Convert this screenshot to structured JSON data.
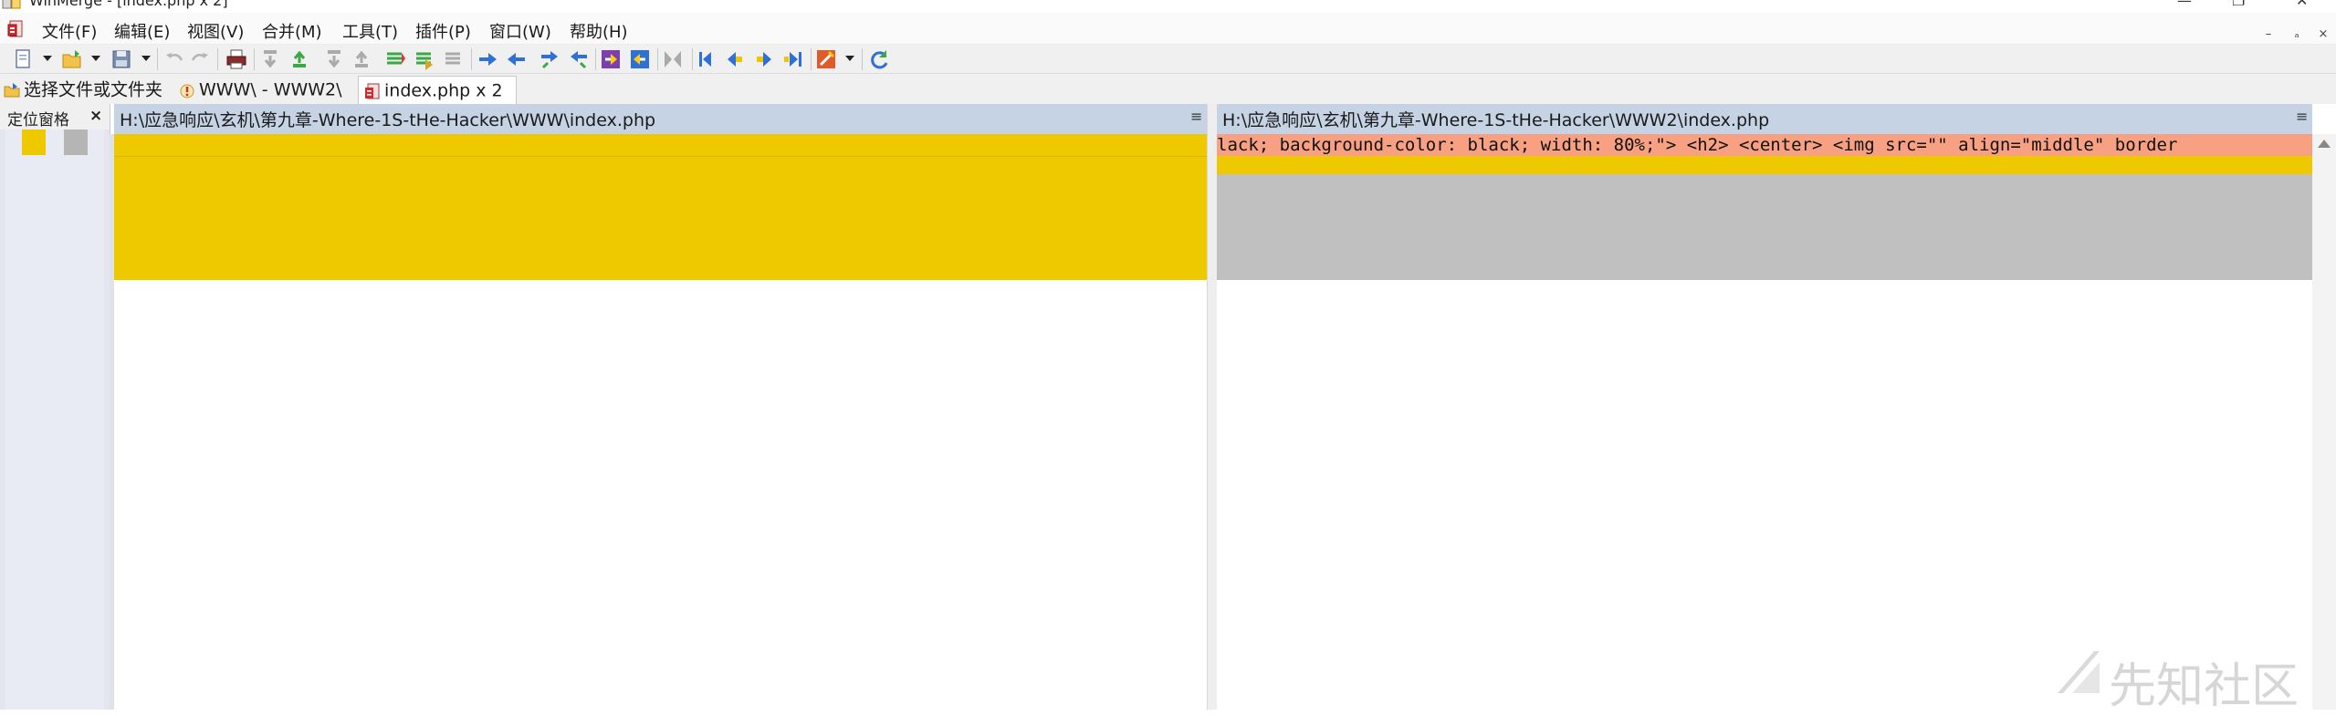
{
  "window": {
    "title": "WinMerge - [index.php x 2]",
    "controls": [
      "—",
      "❐",
      "✕"
    ]
  },
  "menu": {
    "items": [
      "文件(F)",
      "编辑(E)",
      "视图(V)",
      "合并(M)",
      "工具(T)",
      "插件(P)",
      "窗口(W)",
      "帮助(H)"
    ],
    "mdi_controls": [
      "–",
      "ₐ",
      "×"
    ]
  },
  "tabs": [
    {
      "label": "选择文件或文件夹",
      "icon": "open-folder-icon",
      "active": false
    },
    {
      "label": "WWW\\ - WWW2\\",
      "icon": "folder-compare-icon",
      "active": false
    },
    {
      "label": "index.php x 2",
      "icon": "file-compare-icon",
      "active": true
    }
  ],
  "location_pane": {
    "title": "定位窗格",
    "close": "×"
  },
  "left_pane": {
    "path": "H:\\应急响应\\玄机\\第九章-Where-1S-tHe-Hacker\\WWW\\index.php",
    "menu_icon": "≡"
  },
  "right_pane": {
    "path": "H:\\应急响应\\玄机\\第九章-Where-1S-tHe-Hacker\\WWW2\\index.php",
    "menu_icon": "≡",
    "line_1": "lack; background-color: black; width: 80%;\"> <h2> <center> <img src=\"\" align=\"middle\" border"
  },
  "colors": {
    "diff_yellow": "#efc900",
    "diff_salmon": "#f7a082",
    "missing_gray": "#c0c0c0",
    "pane_header": "#c5d3e4"
  },
  "watermark": {
    "text": "先知社区"
  }
}
